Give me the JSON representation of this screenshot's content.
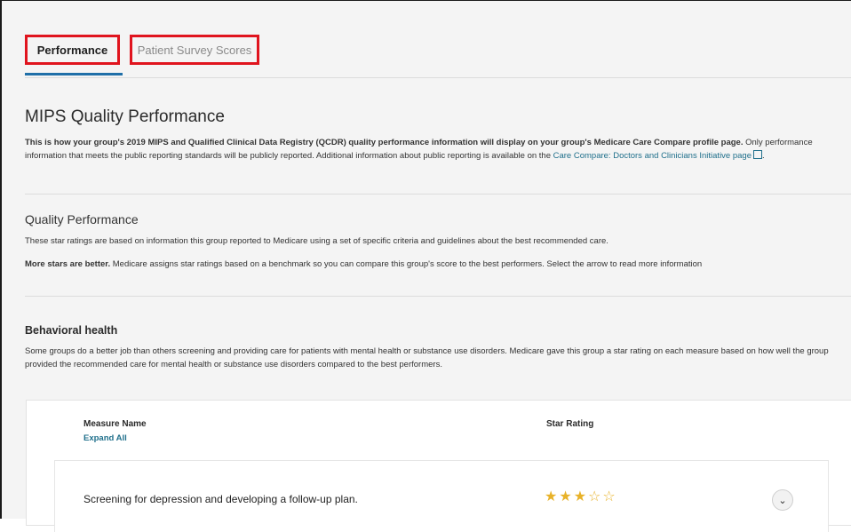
{
  "tabs": {
    "performance": "Performance",
    "survey": "Patient Survey Scores"
  },
  "mips": {
    "title": "MIPS Quality Performance",
    "intro_bold": "This is how your group's 2019 MIPS and Qualified Clinical Data Registry (QCDR) quality performance information will display on your group's Medicare Care Compare profile page.",
    "intro_rest": " Only performance information that meets the public reporting standards will be publicly reported. Additional information about public reporting is available on the ",
    "intro_link": "Care Compare: Doctors and Clinicians Initiative page",
    "intro_end": "."
  },
  "quality": {
    "title": "Quality Performance",
    "desc": "These star ratings are based on information this group reported to Medicare using a set of specific criteria and guidelines about the best recommended care.",
    "more_bold": "More stars are better.",
    "more_rest": " Medicare assigns star ratings based on a benchmark so you can compare this group's score to the best performers. Select the arrow to read more information"
  },
  "behavioral": {
    "title": "Behavioral health",
    "desc": "Some groups do a better job than others screening and providing care for patients with mental health or substance use disorders. Medicare gave this group a star rating on each measure based on how well the group provided the recommended care for mental health or substance use disorders compared to the best performers."
  },
  "table": {
    "col_name": "Measure Name",
    "expand_all": "Expand All",
    "col_star": "Star Rating",
    "rows": [
      {
        "name": "Screening for depression and developing a follow-up plan.",
        "stars_filled": 3,
        "stars_total": 5
      }
    ]
  },
  "colors": {
    "highlight_border": "#e0141e",
    "active_tab_underline": "#1f6fa8",
    "link": "#1f6f8b",
    "star": "#e8b229"
  }
}
